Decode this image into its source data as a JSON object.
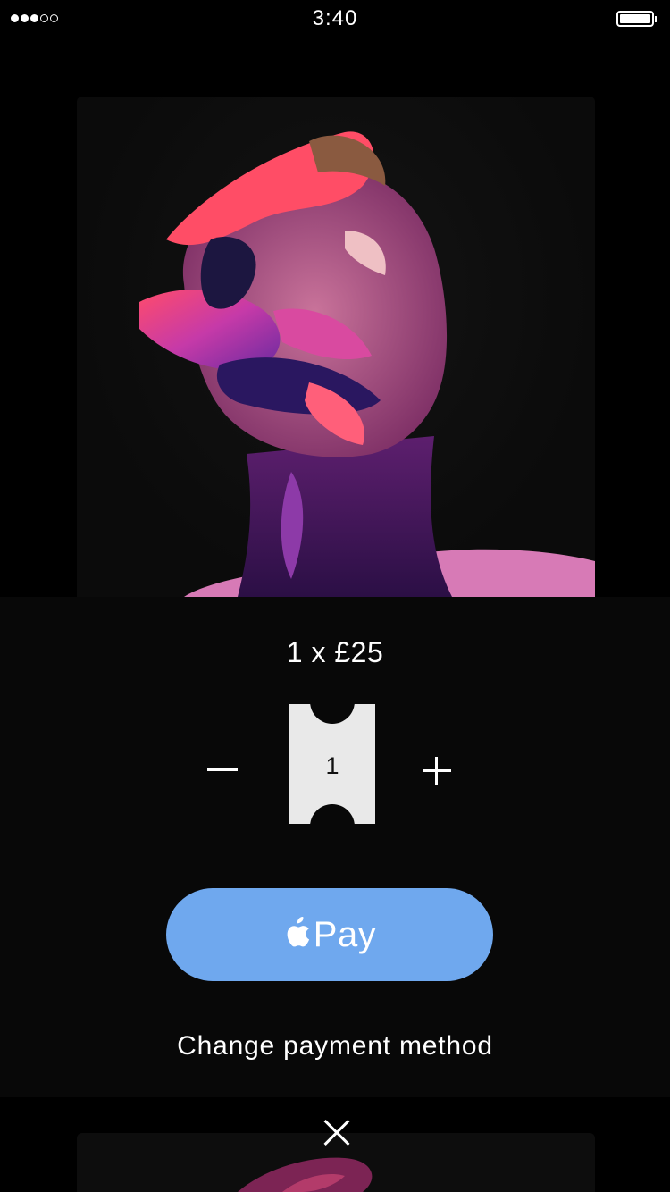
{
  "status_bar": {
    "time": "3:40",
    "signal_strength": 3,
    "signal_max": 5,
    "battery_level": 1.0
  },
  "artwork": {
    "icon": "painted-face-artwork-image"
  },
  "purchase": {
    "price_summary": "1 x £25",
    "quantity": "1",
    "decrement_icon": "minus-icon",
    "increment_icon": "plus-icon"
  },
  "apple_pay": {
    "label": "Pay",
    "icon": "apple-logo-icon",
    "color": "#6fa8ee"
  },
  "change_payment_label": "Change payment method",
  "close_icon": "close-icon"
}
